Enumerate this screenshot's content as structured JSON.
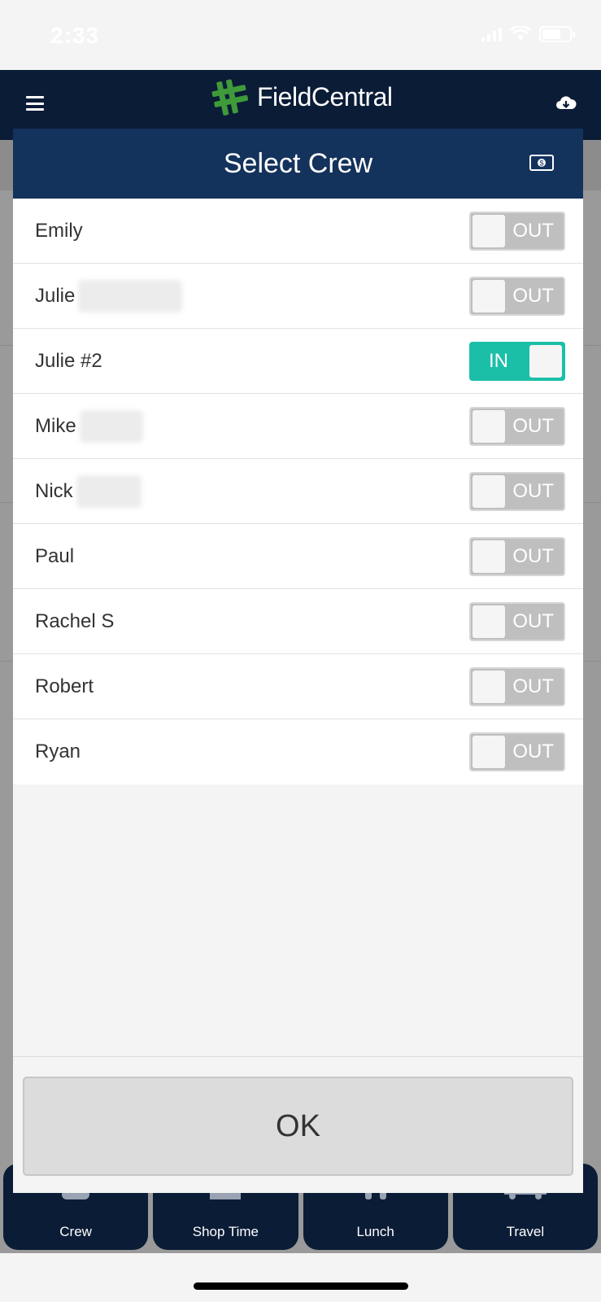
{
  "status_bar": {
    "time": "2:33"
  },
  "header": {
    "app_name": "FieldCentral",
    "logo_color": "#3f9a3a"
  },
  "modal": {
    "title": "Select Crew",
    "crew": [
      {
        "name": "Emily",
        "status": "OUT"
      },
      {
        "name": "Julie",
        "status": "OUT"
      },
      {
        "name": "Julie #2",
        "status": "IN"
      },
      {
        "name": "Mike",
        "status": "OUT"
      },
      {
        "name": "Nick",
        "status": "OUT"
      },
      {
        "name": "Paul",
        "status": "OUT"
      },
      {
        "name": "Rachel S",
        "status": "OUT"
      },
      {
        "name": "Robert",
        "status": "OUT"
      },
      {
        "name": "Ryan",
        "status": "OUT"
      }
    ],
    "ok_label": "OK"
  },
  "tabs": [
    {
      "label": "Crew",
      "icon": "crew-icon"
    },
    {
      "label": "Shop Time",
      "icon": "shop-icon"
    },
    {
      "label": "Lunch",
      "icon": "lunch-icon"
    },
    {
      "label": "Travel",
      "icon": "truck-icon"
    }
  ],
  "colors": {
    "header_bg": "#0b1c36",
    "modal_header_bg": "#13325c",
    "toggle_on": "#1bbfa8",
    "toggle_off": "#bfbfbf"
  }
}
